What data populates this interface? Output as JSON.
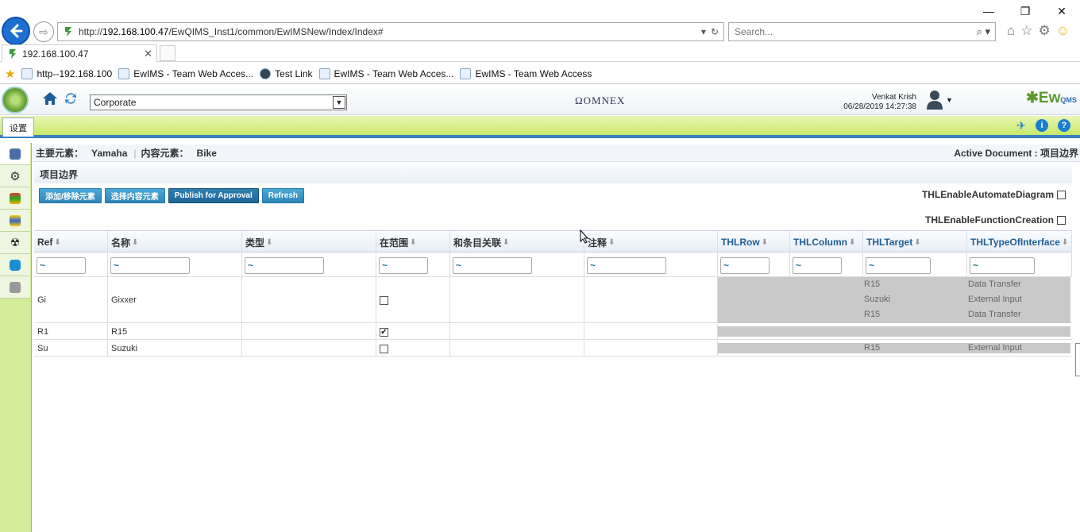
{
  "browser": {
    "url_prefix": "http://",
    "url_host": "192.168.100.47",
    "url_path": "/EwQIMS_Inst1/common/EwIMSNew/Index/Index#",
    "search_placeholder": "Search...",
    "tab_title": "192.168.100.47",
    "favorites": [
      "http--192.168.100",
      "EwIMS - Team Web Acces...",
      "Test Link",
      "EwIMS - Team Web Acces...",
      "EwIMS - Team Web Access"
    ]
  },
  "header": {
    "org_selected": "Corporate",
    "center_logo": "OMNEX",
    "user_name": "Venkat Krish",
    "timestamp": "06/28/2019 14:27:38",
    "brand": "Ew",
    "brand_sub": "IMS\nQMS"
  },
  "module_tab": "设置",
  "context": {
    "primary_label": "主要元素：",
    "primary_value": "Yamaha",
    "content_label": "内容元素：",
    "content_value": "Bike",
    "active_doc": "Active Document : 项目边界"
  },
  "panel": {
    "title": "项目边界",
    "buttons": [
      "添加/移除元素",
      "选择内容元素",
      "Publish for Approval",
      "Refresh"
    ],
    "option_automate": "THLEnableAutomateDiagram",
    "option_function": "THLEnableFunctionCreation"
  },
  "grid": {
    "columns": [
      "Ref",
      "名称",
      "类型",
      "在范围",
      "和条目关联",
      "注释",
      "THLRow",
      "THLColumn",
      "THLTarget",
      "THLTypeOfInterface"
    ],
    "filter_value": "~",
    "rows": [
      {
        "ref": "Gi",
        "name": "Gixxer",
        "in_scope": false,
        "thl": [
          {
            "target": "R15",
            "type": "Data Transfer"
          },
          {
            "target": "Suzuki",
            "type": "External Input"
          },
          {
            "target": "R15",
            "type": "Data Transfer"
          }
        ]
      },
      {
        "ref": "R1",
        "name": "R15",
        "in_scope": true,
        "thl": []
      },
      {
        "ref": "Su",
        "name": "Suzuki",
        "in_scope": false,
        "thl": [
          {
            "target": "R15",
            "type": "External Input"
          }
        ]
      }
    ]
  },
  "colors": {
    "accent_blue": "#2f86b7",
    "module_green": "#c8e86a",
    "thl_gray": "#c9c9c9"
  }
}
